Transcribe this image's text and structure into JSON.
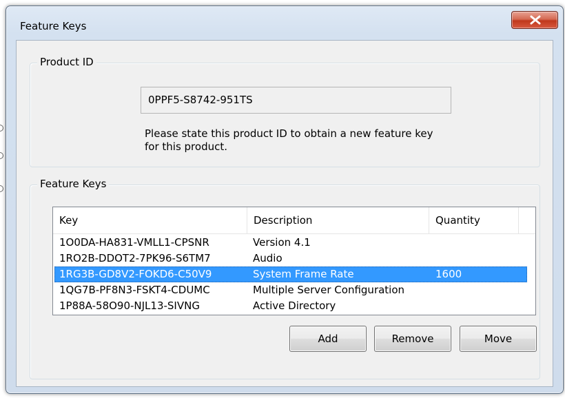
{
  "dialog": {
    "title": "Feature Keys",
    "close_icon": "close-icon"
  },
  "product_id": {
    "legend": "Product ID",
    "value": "0PPF5-S8742-951TS",
    "instruction_line1": "Please state this product ID to obtain a new feature key",
    "instruction_line2": "for this product."
  },
  "feature_keys": {
    "legend": "Feature Keys",
    "columns": [
      "Key",
      "Description",
      "Quantity"
    ],
    "rows": [
      {
        "key": "1O0DA-HA831-VMLL1-CPSNR",
        "description": "Version 4.1",
        "quantity": "",
        "selected": false
      },
      {
        "key": "1RO2B-DDOT2-7PK96-S6TM7",
        "description": "Audio",
        "quantity": "",
        "selected": false
      },
      {
        "key": "1RG3B-GD8V2-FOKD6-C50V9",
        "description": "System Frame Rate",
        "quantity": "1600",
        "selected": true
      },
      {
        "key": "1QG7B-PF8N3-FSKT4-CDUMC",
        "description": "Multiple Server Configuration",
        "quantity": "",
        "selected": false
      },
      {
        "key": "1P88A-58O90-NJL13-SIVNG",
        "description": "Active Directory",
        "quantity": "",
        "selected": false
      }
    ],
    "selection_color": "#3399ff"
  },
  "buttons": {
    "add": "Add",
    "remove": "Remove",
    "move": "Move"
  }
}
